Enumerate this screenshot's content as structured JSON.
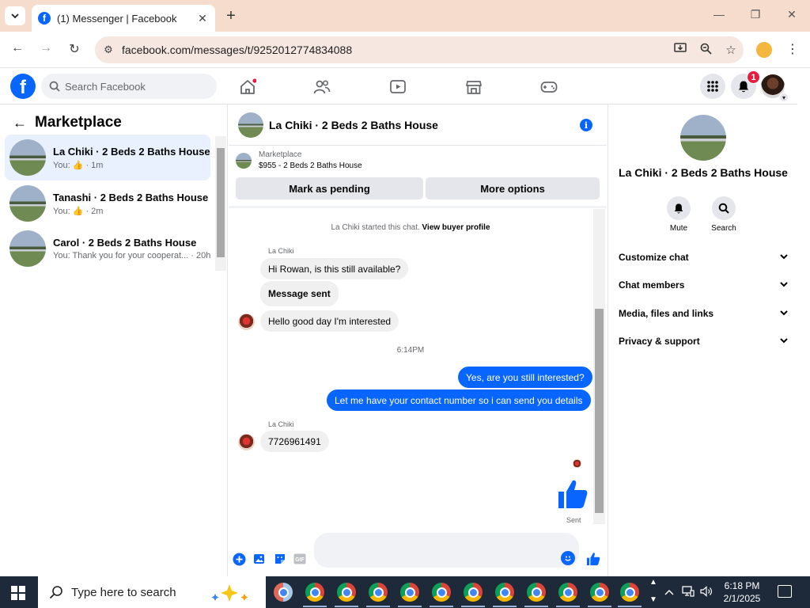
{
  "browser": {
    "tab_title": "(1) Messenger | Facebook",
    "tab_close": "✕",
    "new_tab": "+",
    "url": "facebook.com/messages/t/9252012774834088",
    "win_minimize": "—",
    "win_restore": "❐",
    "win_close": "✕"
  },
  "fb_header": {
    "logo": "f",
    "search_placeholder": "Search Facebook",
    "notification_count": "1"
  },
  "left_panel": {
    "title": "Marketplace",
    "conversations": [
      {
        "name": "La Chiki · 2 Beds 2 Baths House",
        "prefix": "You: ",
        "like": "👍",
        "suffix": " · 1m"
      },
      {
        "name": "Tanashi · 2 Beds 2 Baths House",
        "prefix": "You: ",
        "like": "👍",
        "suffix": " · 2m"
      },
      {
        "name": "Carol · 2 Beds 2 Baths House",
        "preview": "You: Thank you for your cooperat... · 20h"
      }
    ]
  },
  "chat": {
    "title": "La Chiki · 2 Beds 2 Baths House",
    "listing_label": "Marketplace",
    "listing_price": "$955 - 2 Beds 2 Baths House",
    "mark_pending": "Mark as pending",
    "more_options": "More options",
    "system_text": "La Chiki started this chat.",
    "system_link": "View buyer profile",
    "sender_name": "La Chiki",
    "messages_in": [
      "Hi Rowan, is this still available?",
      "Message sent",
      "Hello good day I'm interested",
      "7726961491"
    ],
    "timestamp": "6:14PM",
    "messages_out": [
      "Yes, are you still interested?",
      "Let me have your contact number so i can send you details"
    ],
    "sent_label": "Sent"
  },
  "right_panel": {
    "name": "La Chiki · 2 Beds 2 Baths House",
    "mute": "Mute",
    "search": "Search",
    "sections": [
      "Customize chat",
      "Chat members",
      "Media, files and links",
      "Privacy & support"
    ]
  },
  "taskbar": {
    "search_placeholder": "Type here to search",
    "time": "6:18 PM",
    "date": "2/1/2025"
  },
  "colors": {
    "messenger_blue": "#0866ff",
    "incoming_bubble": "#f0f0f0",
    "taskbar": "#1e2a3a"
  }
}
